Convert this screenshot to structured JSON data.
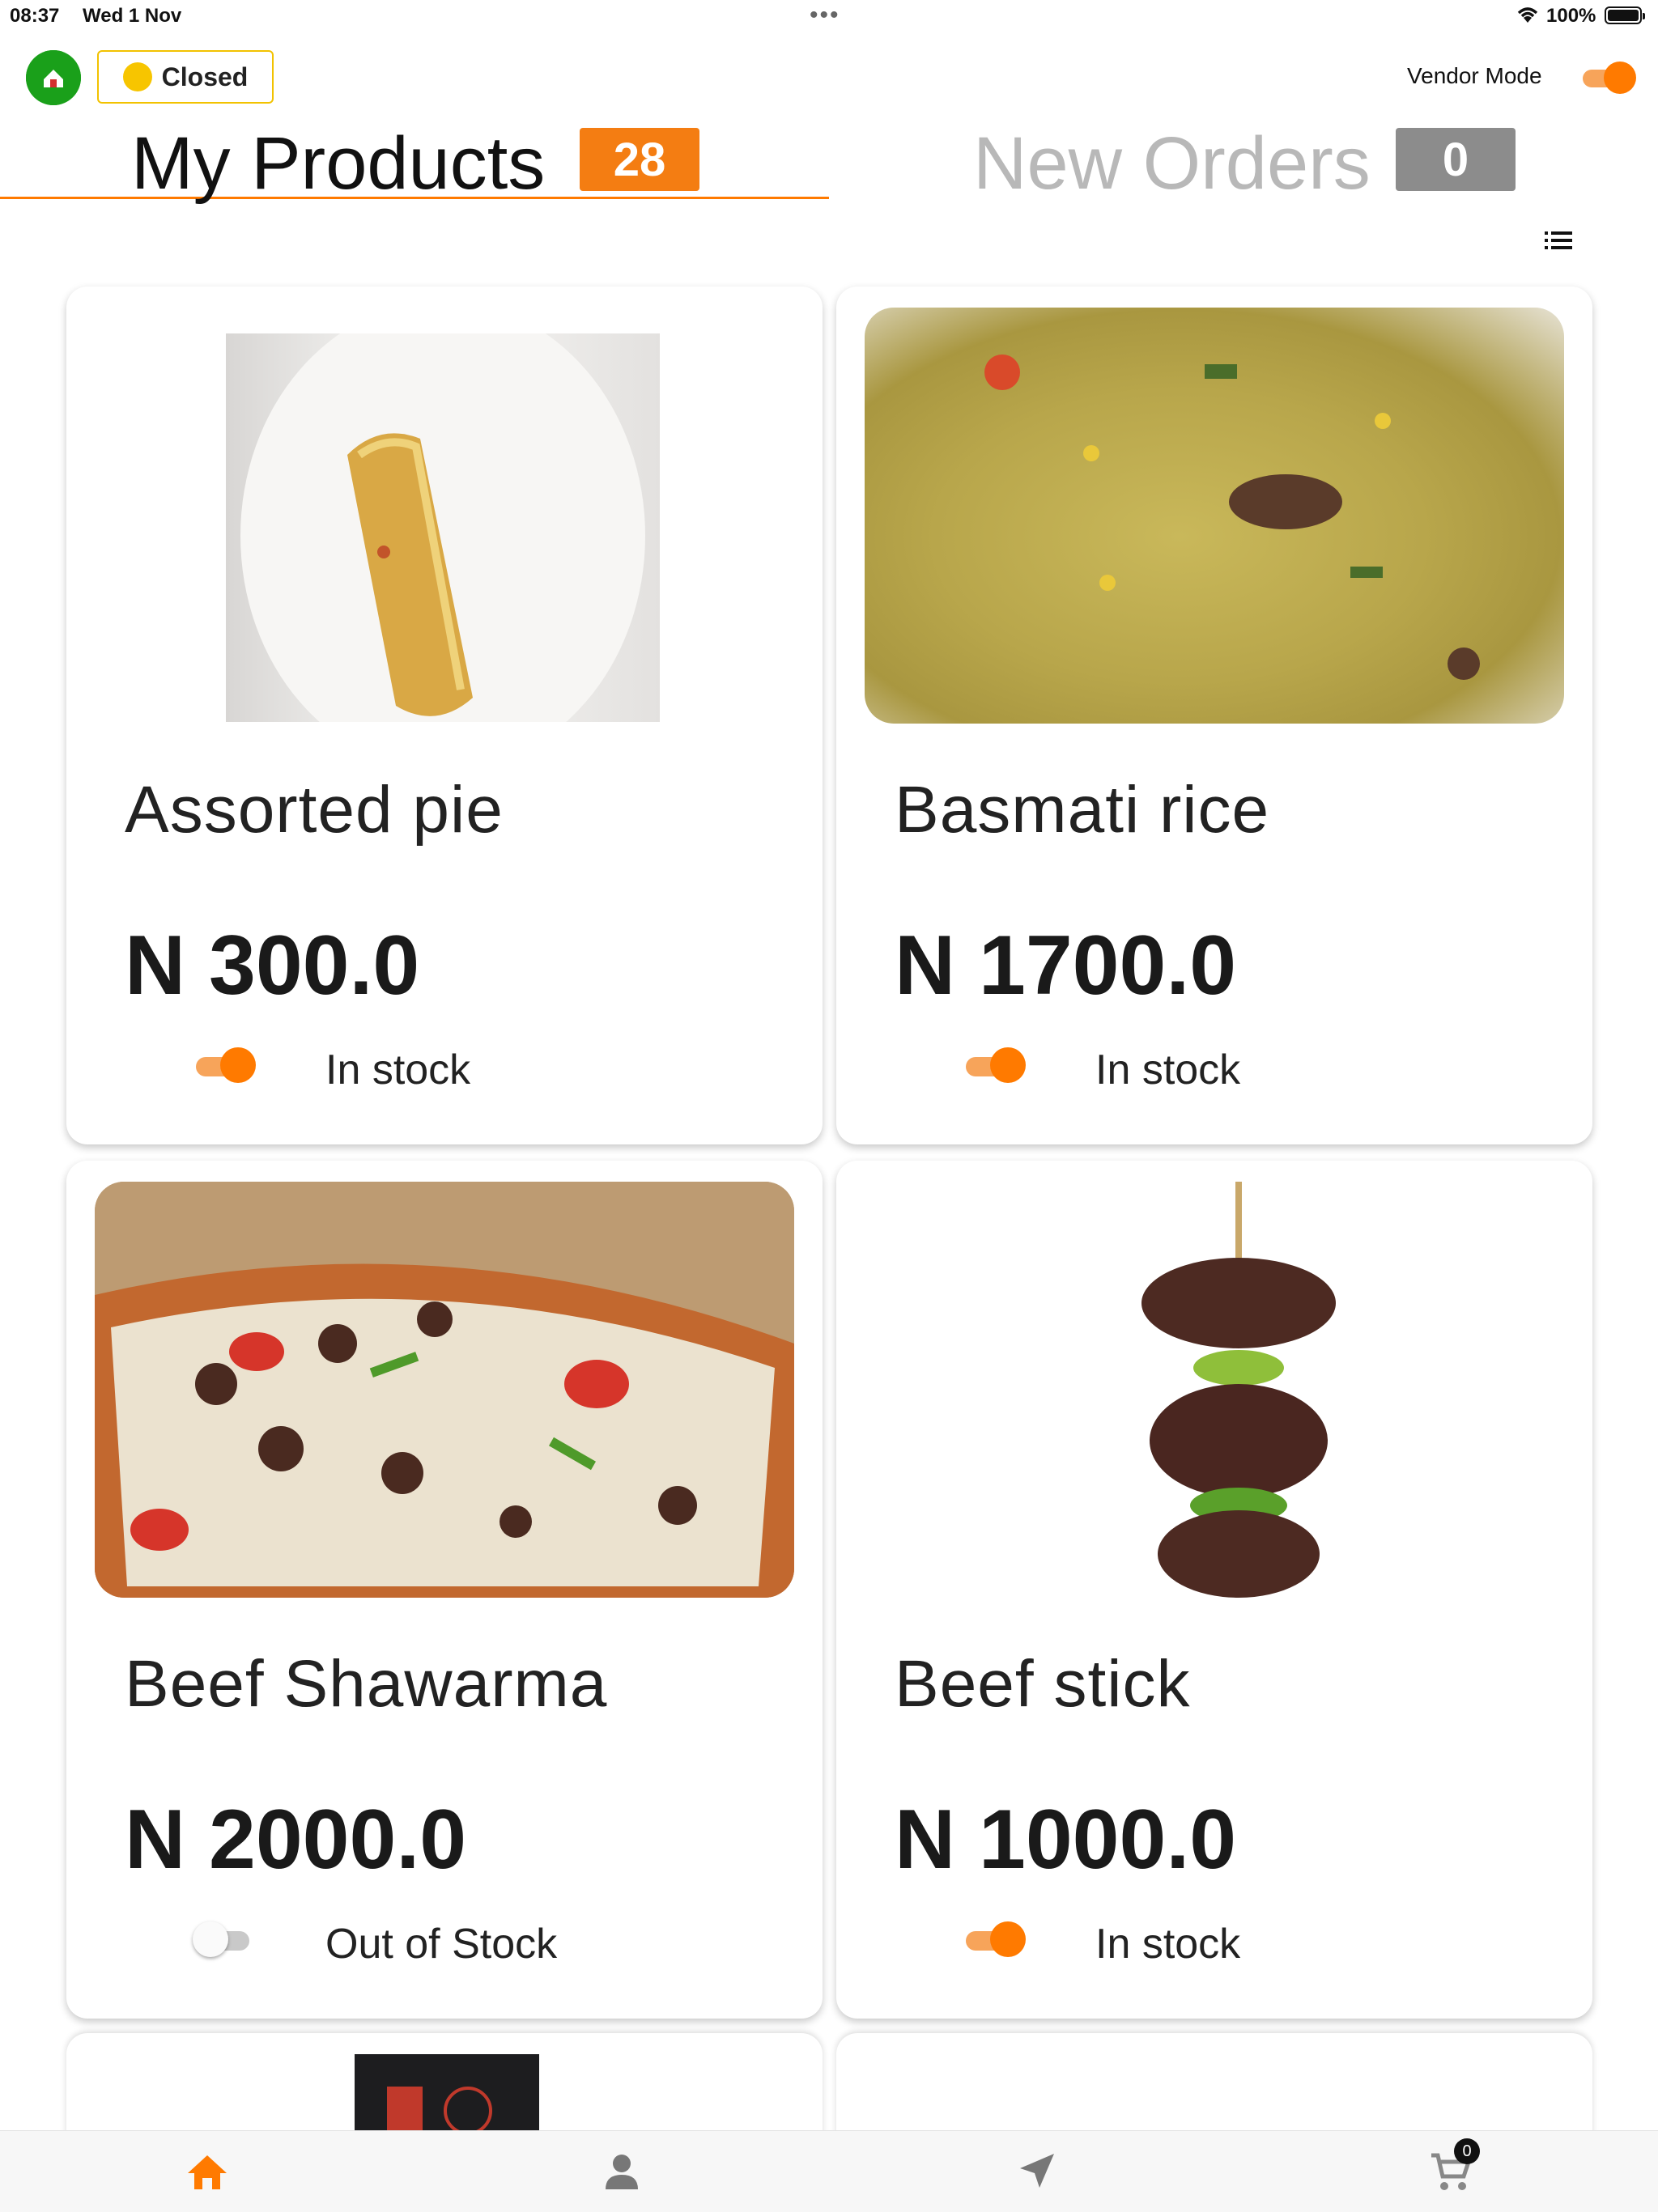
{
  "status_bar": {
    "time": "08:37",
    "date": "Wed 1 Nov",
    "battery": "100%"
  },
  "header": {
    "store_status_label": "Closed",
    "vendor_mode_label": "Vendor Mode",
    "vendor_mode_on": true
  },
  "tabs": [
    {
      "label": "My Products",
      "count": "28",
      "active": true
    },
    {
      "label": "New Orders",
      "count": "0",
      "active": false
    }
  ],
  "products": [
    {
      "name": "Assorted pie",
      "price": "N 300.0",
      "stock_label": "In stock",
      "in_stock": true
    },
    {
      "name": "Basmati rice",
      "price": "N 1700.0",
      "stock_label": "In stock",
      "in_stock": true
    },
    {
      "name": "Beef Shawarma",
      "price": "N 2000.0",
      "stock_label": "Out of Stock",
      "in_stock": false
    },
    {
      "name": "Beef stick",
      "price": "N 1000.0",
      "stock_label": "In stock",
      "in_stock": true
    }
  ],
  "bottom_nav": {
    "items": [
      "home-icon",
      "profile-icon",
      "navigation-icon",
      "cart-icon"
    ],
    "cart_count": "0"
  },
  "colors": {
    "accent": "#ff7a00",
    "badge_active": "#f47d12",
    "badge_inactive": "#8c8c8c"
  }
}
